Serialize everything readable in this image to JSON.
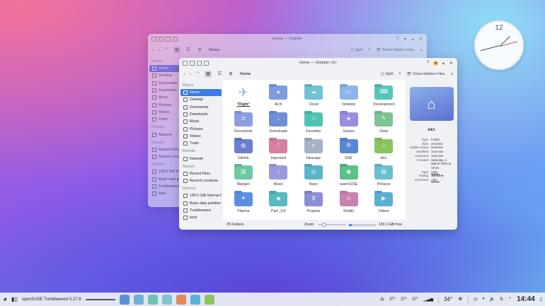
{
  "clock_widget": {
    "number": "12"
  },
  "back_window": {
    "title": "Home — Dolphin",
    "breadcrumb": "Home",
    "split_label": "Split",
    "hidden_label": "Show Hidden Files",
    "sidebar": {
      "places_header": "Places",
      "places": [
        "Home",
        "Desktop",
        "Documents",
        "Downloads",
        "Music",
        "Pictures",
        "Videos",
        "Trash"
      ],
      "remote_header": "Remote",
      "remote": [
        "Network"
      ],
      "recent_header": "Recent",
      "recent": [
        "Recent Files",
        "Recent Locati"
      ],
      "devices_header": "Devices",
      "devices": [
        "149.5 GiB Inter",
        "Basic data pa",
        "Tumbleweed",
        "boot"
      ]
    }
  },
  "front_window": {
    "title": "Home — Dolphin <2>",
    "breadcrumb": "Home",
    "split_label": "Split",
    "hidden_label": "Show Hidden Files",
    "sidebar": {
      "places_header": "Places",
      "places": [
        "Home",
        "Desktop",
        "Documents",
        "Downloads",
        "Music",
        "Pictures",
        "Videos",
        "Trash"
      ],
      "remote_header": "Remote",
      "remote": [
        "Network"
      ],
      "recent_header": "Recent",
      "recent": [
        "Recent Files",
        "Recent Locations"
      ],
      "devices_header": "Devices",
      "devices": [
        "149.5 GiB Internal D...",
        "Basic data partition",
        "Tumbleweed",
        "boot"
      ]
    },
    "files": [
      {
        "name": "\"Flight\"",
        "color": "#dfe6f1",
        "icon": "flight-icon"
      },
      {
        "name": "Arch",
        "color": "#7d9de0",
        "icon": "arch-icon"
      },
      {
        "name": "Cloud",
        "color": "#6fc2d8",
        "icon": "cloud-icon"
      },
      {
        "name": "Desktop",
        "color": "#8fb4ea",
        "icon": "desktop-icon"
      },
      {
        "name": "Development",
        "color": "#55c6b8",
        "icon": "development-icon"
      },
      {
        "name": "Documents",
        "color": "#8c9ee0",
        "icon": "documents-icon"
      },
      {
        "name": "Downloads",
        "color": "#6d8fd6",
        "icon": "downloads-icon"
      },
      {
        "name": "Favorites",
        "color": "#4fc4b5",
        "icon": "star-icon"
      },
      {
        "name": "Games",
        "color": "#9a8de0",
        "icon": "games-icon"
      },
      {
        "name": "Gimp",
        "color": "#7ec295",
        "icon": "gimp-icon"
      },
      {
        "name": "GitHub",
        "color": "#6a7dcf",
        "icon": "github-icon"
      },
      {
        "name": "Important",
        "color": "#d77ea1",
        "icon": "important-icon"
      },
      {
        "name": "Inkscape",
        "color": "#a7b2c9",
        "icon": "inkscape-icon"
      },
      {
        "name": "KDE",
        "color": "#5a86d8",
        "icon": "kde-icon"
      },
      {
        "name": "lxk1",
        "color": "#8bc45d",
        "icon": "lxk1-icon"
      },
      {
        "name": "Manjaro",
        "color": "#6ec9a0",
        "icon": "manjaro-icon"
      },
      {
        "name": "Music",
        "color": "#9a9ae0",
        "icon": "music-icon"
      },
      {
        "name": "Neon",
        "color": "#58b6c8",
        "icon": "neon-icon"
      },
      {
        "name": "openSUSE",
        "color": "#59c287",
        "icon": "opensuse-icon"
      },
      {
        "name": "Pictures",
        "color": "#6bbfd0",
        "icon": "pictures-icon"
      },
      {
        "name": "Plasma",
        "color": "#5a8fe0",
        "icon": "plasma-icon"
      },
      {
        "name": "Pop!_OS",
        "color": "#58b9c0",
        "icon": "popos-icon"
      },
      {
        "name": "Projects",
        "color": "#8c8ed6",
        "icon": "projects-icon"
      },
      {
        "name": "Reddit",
        "color": "#c884b0",
        "icon": "reddit-icon"
      },
      {
        "name": "Videos",
        "color": "#5ab0d0",
        "icon": "videos-icon"
      }
    ],
    "status": {
      "folders": "25 Folders",
      "zoom_label": "Zoom:",
      "free": "129.1 GiB free",
      "used_fraction": 0.12
    },
    "info": {
      "name": "lxk1",
      "rows": [
        {
          "k": "Type:",
          "v": "Folder"
        },
        {
          "k": "Size:",
          "v": "25 items"
        },
        {
          "k": "Hidden items:",
          "v": "26 items"
        },
        {
          "k": "Modified:",
          "v": "Just now"
        },
        {
          "k": "Accessed:",
          "v": "Just now"
        },
        {
          "k": "Created:",
          "v": "Saturday, 4 March 2023 at 19:36"
        }
      ],
      "tags_label": "Tags:",
      "tags_value": "Add...",
      "rating_label": "Rating:",
      "rating": 5,
      "comment_label": "Comment:",
      "comment_value": "Add..."
    }
  },
  "panel": {
    "task_label": "openSUSE Tumbleweed 5.27.6",
    "temps": [
      "37°",
      "37°",
      "37°"
    ],
    "weather_temp": "34°",
    "time": "14:44"
  }
}
